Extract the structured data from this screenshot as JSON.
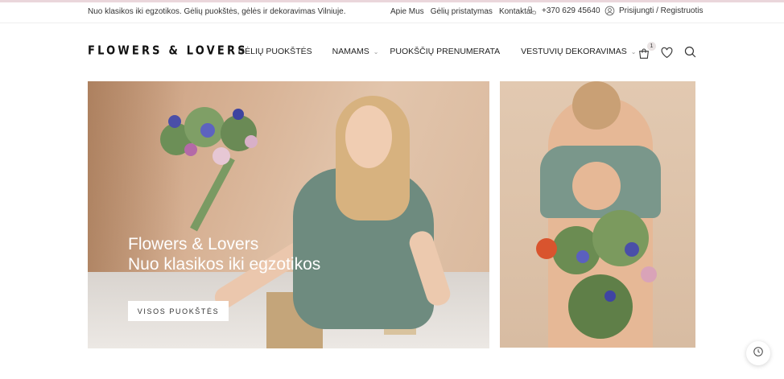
{
  "topbar": {
    "tagline": "Nuo klasikos iki egzotikos. Gėlių puokštės, gėlės ir dekoravimas Vilniuje.",
    "links": [
      "Apie Mus",
      "Gėlių pristatymas",
      "Kontaktai"
    ],
    "phone": "+370 629 45640",
    "account": "Prisijungti / Registruotis"
  },
  "logo": "FLOWERS & LOVERS",
  "nav": [
    {
      "label": "GĖLIŲ PUOKŠTĖS",
      "dropdown": false
    },
    {
      "label": "NAMAMS",
      "dropdown": true
    },
    {
      "label": "PUOKŠČIŲ PRENUMERATA",
      "dropdown": false
    },
    {
      "label": "VESTUVIŲ DEKORAVIMAS",
      "dropdown": true
    }
  ],
  "cart": {
    "count": "1"
  },
  "icons": [
    "phone-icon",
    "user-icon",
    "cart-icon",
    "heart-icon",
    "search-icon",
    "clock-icon"
  ],
  "hero": {
    "title_line1": "Flowers & Lovers",
    "title_line2": "Nuo klasikos iki egzotikos",
    "button": "VISOS PUOKŠTĖS"
  },
  "colors": {
    "accent": "#ead6db",
    "text": "#222222",
    "button_bg": "#ffffff"
  }
}
